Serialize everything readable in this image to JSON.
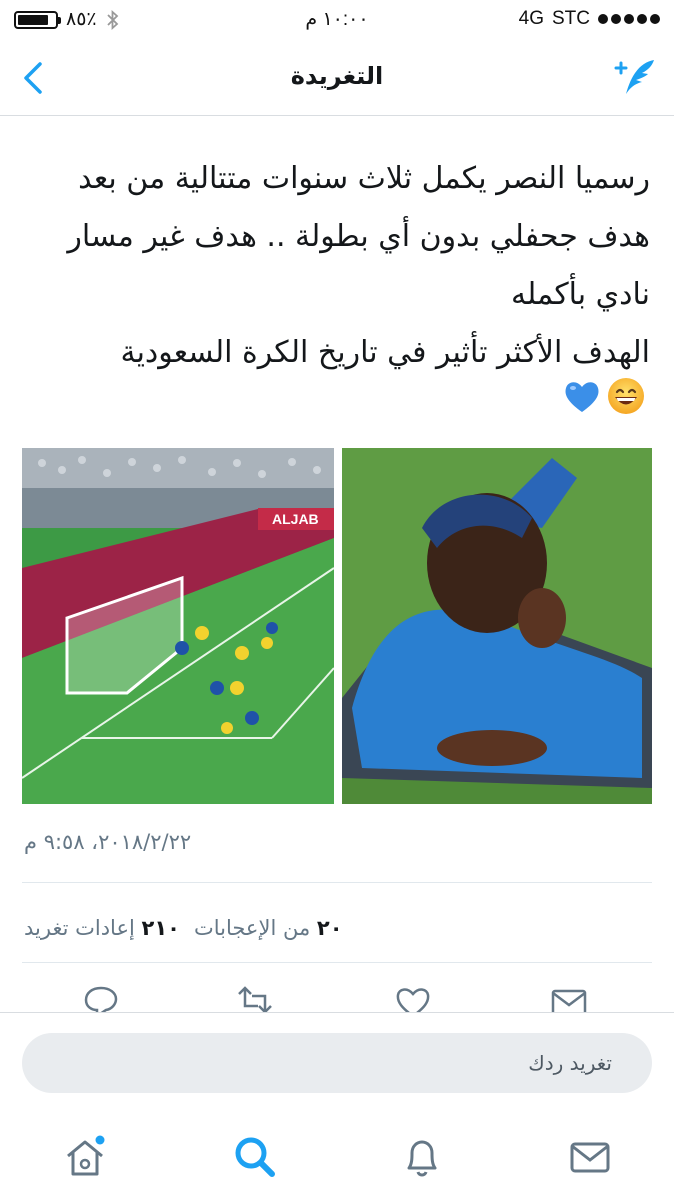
{
  "status_bar": {
    "battery_text": "٨٥٪",
    "battery_level": 0.85,
    "time": "١٠:٠٠ م",
    "network": "4G",
    "carrier": "STC"
  },
  "nav": {
    "title": "التغريدة"
  },
  "tweet": {
    "lines": [
      "رسميا النصر يكمل ثلاث سنوات متتالية من بعد",
      "هدف جحفلي بدون أي بطولة .. هدف غير مسار",
      "نادي بأكمله",
      "الهدف الأكثر تأثير في تاريخ الكرة السعودية"
    ],
    "emojis": [
      "grinning-face",
      "blue-heart"
    ],
    "timestamp": "٢٠١٨/٢/٢٢، ٩:٥٨ م",
    "likes_count": "٢٠",
    "likes_label": "من الإعجابات",
    "retweets_count": "٢١٠",
    "retweets_label": "إعادات تغريد",
    "media_banner": "ALJAB"
  },
  "reply": {
    "placeholder": "تغريد ردك"
  },
  "colors": {
    "accent": "#1da1f2",
    "gray_text": "#657786",
    "divider": "#e1e8ed"
  }
}
